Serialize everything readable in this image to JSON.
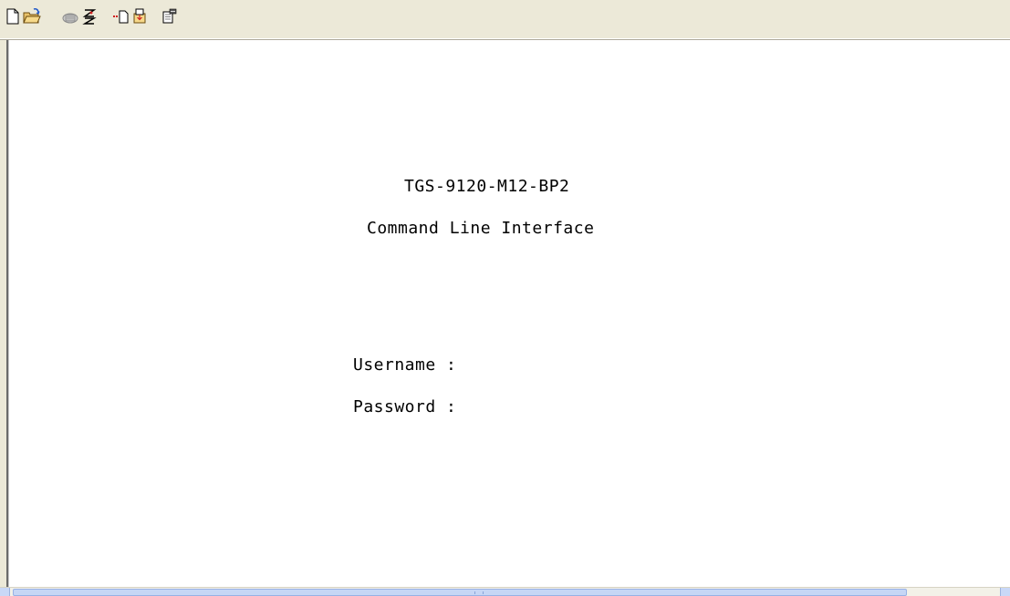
{
  "toolbar": {
    "buttons": [
      {
        "icon": "new-document-icon"
      },
      {
        "icon": "open-folder-icon"
      },
      {
        "icon": "disconnect-phone-icon"
      },
      {
        "icon": "dial-icon"
      },
      {
        "icon": "send-file-icon"
      },
      {
        "icon": "receive-file-icon"
      },
      {
        "icon": "properties-icon"
      }
    ]
  },
  "terminal": {
    "device_name": "TGS-9120-M12-BP2",
    "subtitle": "Command Line Interface",
    "username_prompt": "Username :",
    "password_prompt": "Password :",
    "username_value": "",
    "password_value": ""
  },
  "colors": {
    "toolbar_bg": "#ece9d8",
    "terminal_bg": "#ffffff",
    "terminal_text": "#000000",
    "scrollbar_thumb": "#c6d6f5"
  }
}
